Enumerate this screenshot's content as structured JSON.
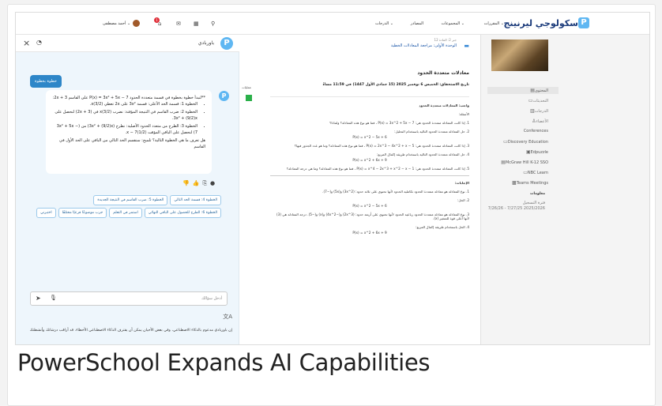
{
  "caption": "PowerSchool Expands AI Capabilities",
  "topbar": {
    "brand": "سكولوجي ليرنينج",
    "nav": [
      "المقررات ⌄",
      "المجموعات ⌄",
      "المصادر",
      "الدرجات ⌄"
    ],
    "user": "أحمد مصطفى ⌄",
    "notif_count": "1"
  },
  "chat": {
    "title": "باوربادي",
    "step_button": "خطوة بخطوة",
    "intro": "**لنبدأ خطوة بخطوة في قسمة متعددة الحدود P(x) = 3x² + 5x − 7 على القاسم 2x + 3:",
    "steps": [
      "الخطوة 1: قسمة الحد الأعلى: قسمة 3x² على 2x تعطي (3/2)x.",
      "الخطوة 2: ضرب القاسم في النتيجة المؤقتة: نضرب (3/2)x في (2x + 3) لنحصل على 3x² + (9/2)x.",
      "الخطوة 3: الطرح من متعدد الحدود الأصلية: نطرح (3x² + (9/2)x) من (3x² + 5x − 7) لنحصل على الباقي المؤقت (1/2)x − 7."
    ],
    "question": "هل تعرف ما هي الخطوة التالية؟ تلميح: سنقسم الحد التالي من الباقي على الحد الأول في القاسم",
    "suggestions": [
      "الخطوة 4: قسمة الحد التالي",
      "الخطوة 5: ضرب القاسم في النتيجة الجديدة",
      "الخطوة 6: الطرح للحصول على الباقي النهائي",
      "استمر في التعلم",
      "جرب موضوعًا فرعيًا مختلفًا",
      "اختبرني"
    ],
    "input_placeholder": "أدخل سؤالك",
    "disclaimer": "إن باوربادي مدعوم بالذكاء الاصطناعي، وفي بعض الأحيان يمكن أن يقترف الذكاء الاصطناعي الأخطاء. قد أراقب درشاتك وأنشطتك"
  },
  "main": {
    "crumb_top": "جبر 2: المادة 12",
    "crumb_link": "الوحدة الأولى: مراجعة المعادلات الخطية",
    "title": "معادلات متعددة الحدود",
    "due": "تاريخ الاستحقاق: الخميس 6 نوفمبر 2025 (15 جمادى الأول 1447) في 11:59 مساءً",
    "edge_label": "عمليات",
    "duty": "واجب: المعادلات متعددة الحدود",
    "q_header": "الأسئلة:",
    "questions": [
      "1. إذا كانت المعادلة متعددة الحدود هي: P(x) = 3x^2 + 5x − 7 ، فما هو نوع هذه المعادلة؟ ولماذا؟",
      "2. حل المعادلة متعددة الحدود التالية باستخدام التحليل:",
      "3. إذا كانت المعادلة متعددة الحدود هي: P(x) = 2x^3 − 4x^2 + x − 5 ، فما هو نوع هذه المعادلة؟ وما هو عدد الجذور فيها؟",
      "4. حل المعادلة متعددة الحدود التالية باستخدام طريقة إكمال المربع:",
      "5. إذا كانت المعادلة متعددة الحدود هي: P(x) = x^4 − 2x^3 + x^2 − x − 1 ، فما هو نوع هذه المعادلة؟ وما هي درجة المعادلة؟"
    ],
    "eq2": "P(x) = x^2 − 5x + 6",
    "eq4": "P(x) = x^2 + 6x + 9",
    "a_header": "الإجابات:",
    "answers": [
      "1. نوع المعادلة هو معادلة متعددة الحدود تكاملية الحدود لأنها تحتوي على ثلاثة حدود: (3x^2) و(5x) و(−7).",
      "2. الحل:",
      "3. نوع المعادلة هو معادلة متعددة الحدود رباعية الحدود لأنها تحتوي على أربعة حدود: (2x^3) و(−4x^2) و(x) و(−5). درجة المعادلة هي (3) لأنها أعلى قوة للمتغير (x).",
      "4. الحل باستخدام طريقة إكمال المربع:"
    ]
  },
  "sidebar": {
    "items": [
      "المحتوى",
      "التحديثات",
      "الدرجات",
      "الأعضاء"
    ],
    "tools": [
      "Conferences",
      "Discovery Education",
      "Edpuzzle",
      "McGraw Hill K-12 SSO",
      "NBC Learn",
      "Teams Meetings"
    ],
    "info_head": "معلومات",
    "term_label": "فترة التسجيل",
    "term": "7/26/26 - 7/27/25 2025/2026"
  }
}
